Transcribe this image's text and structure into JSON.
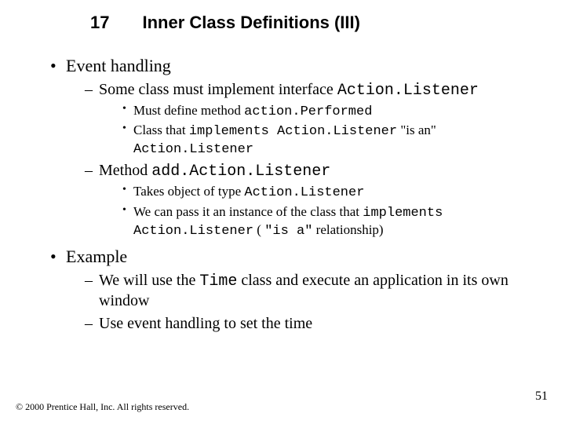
{
  "title": {
    "number": "17",
    "text": "Inner Class Definitions (III)"
  },
  "body": {
    "event_handling": {
      "label": "Event handling",
      "some_class": {
        "pre": "Some class must implement interface ",
        "code": "Action.Listener",
        "children": {
          "must_define": {
            "pre": "Must define method ",
            "code": "action.Performed"
          },
          "class_that": {
            "p0": "Class that ",
            "c0": "implements Action.Listener",
            "p1": " \"is an\" ",
            "c1": "Action.Listener"
          }
        }
      },
      "method_add": {
        "pre": "Method ",
        "code": "add.Action.Listener",
        "children": {
          "takes": {
            "pre": "Takes object of type ",
            "code": "Action.Listener"
          },
          "pass": {
            "p0": "We can pass it an instance of the class that ",
            "c0": "implements Action.Listener",
            "p1": " (",
            "c1": "\"is a\"",
            "p2": " relationship)"
          }
        }
      }
    },
    "example": {
      "label": "Example",
      "use_time": {
        "p0": "We will use the ",
        "c0": "Time",
        "p1": " class and execute an application in its own window"
      },
      "use_event": "Use event handling to set the time"
    }
  },
  "footer": {
    "copyright": "© 2000 Prentice Hall, Inc. All rights reserved.",
    "page": "51"
  }
}
